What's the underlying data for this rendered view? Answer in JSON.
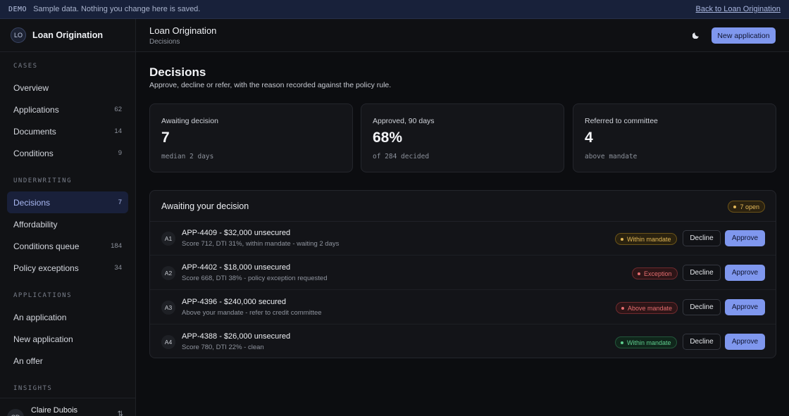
{
  "banner": {
    "tag": "DEMO",
    "message": "Sample data. Nothing you change here is saved.",
    "back_link": "Back to Loan Origination"
  },
  "brand": {
    "initials": "LO",
    "name": "Loan Origination"
  },
  "sidebar": {
    "sections": [
      {
        "label": "CASES",
        "items": [
          {
            "label": "Overview",
            "count": ""
          },
          {
            "label": "Applications",
            "count": "62"
          },
          {
            "label": "Documents",
            "count": "14"
          },
          {
            "label": "Conditions",
            "count": "9"
          }
        ]
      },
      {
        "label": "UNDERWRITING",
        "items": [
          {
            "label": "Decisions",
            "count": "7",
            "active": true
          },
          {
            "label": "Affordability",
            "count": ""
          },
          {
            "label": "Conditions queue",
            "count": "184"
          },
          {
            "label": "Policy exceptions",
            "count": "34"
          }
        ]
      },
      {
        "label": "APPLICATIONS",
        "items": [
          {
            "label": "An application",
            "count": ""
          },
          {
            "label": "New application",
            "count": ""
          },
          {
            "label": "An offer",
            "count": ""
          }
        ]
      },
      {
        "label": "INSIGHTS",
        "items": []
      }
    ],
    "user": {
      "initials": "CD",
      "name": "Claire Dubois",
      "action_icon": "swap-icon"
    }
  },
  "header": {
    "title": "Loan Origination",
    "breadcrumb": "Decisions",
    "theme_icon": "moon-icon",
    "new_button": "New application"
  },
  "page": {
    "title": "Decisions",
    "subtitle": "Approve, decline or refer, with the reason recorded against the policy rule."
  },
  "stats": [
    {
      "label": "Awaiting decision",
      "value": "7",
      "note": "median 2 days"
    },
    {
      "label": "Approved, 90 days",
      "value": "68%",
      "note": "of 284 decided"
    },
    {
      "label": "Referred to committee",
      "value": "4",
      "note": "above mandate"
    }
  ],
  "queue": {
    "title": "Awaiting your decision",
    "badge": "7 open",
    "decline_label": "Decline",
    "approve_label": "Approve",
    "rows": [
      {
        "index": "A1",
        "title": "APP-4409 - $32,000 unsecured",
        "detail": "Score 712, DTI 31%, within mandate - waiting 2 days",
        "status": "Within mandate",
        "status_kind": "within-amber"
      },
      {
        "index": "A2",
        "title": "APP-4402 - $18,000 unsecured",
        "detail": "Score 668, DTI 38% - policy exception requested",
        "status": "Exception",
        "status_kind": "exception"
      },
      {
        "index": "A3",
        "title": "APP-4396 - $240,000 secured",
        "detail": "Above your mandate - refer to credit committee",
        "status": "Above mandate",
        "status_kind": "above"
      },
      {
        "index": "A4",
        "title": "APP-4388 - $26,000 unsecured",
        "detail": "Score 780, DTI 22% - clean",
        "status": "Within mandate",
        "status_kind": "within-green"
      }
    ]
  },
  "colors": {
    "accent": "#7f97ee",
    "active_nav_bg": "#19203a",
    "warning": "#e2b857",
    "danger": "#e56d6f",
    "success": "#5fce8e"
  }
}
